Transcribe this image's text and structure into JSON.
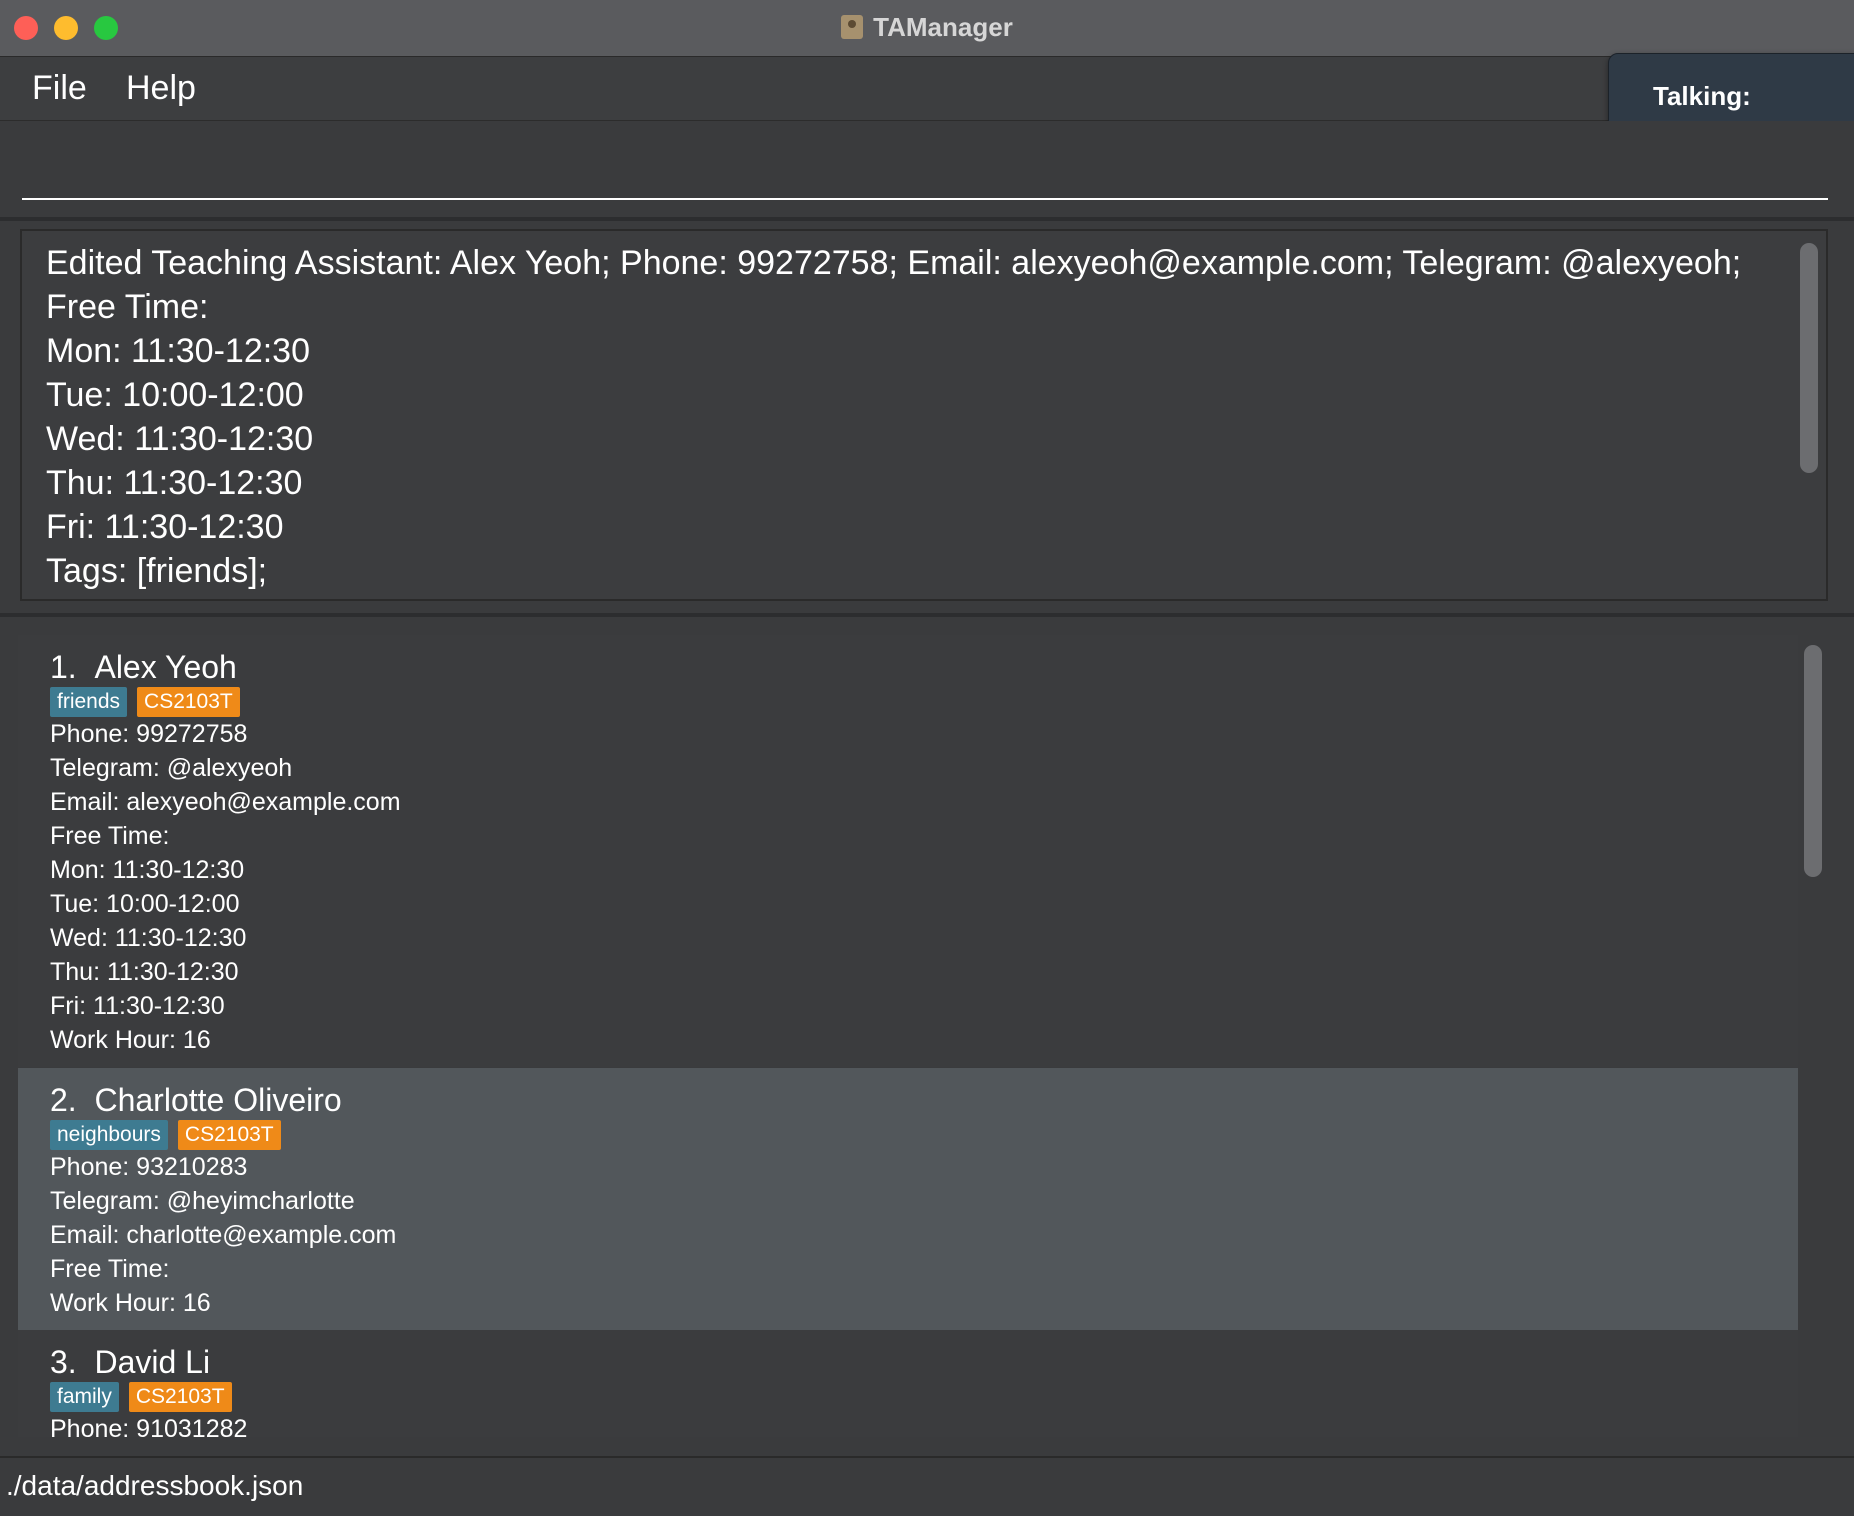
{
  "window": {
    "title": "TAManager"
  },
  "menu": {
    "file": "File",
    "help": "Help"
  },
  "talking_label": "Talking:",
  "command": {
    "value": "",
    "placeholder": ""
  },
  "result": {
    "lines": [
      "Edited Teaching Assistant: Alex Yeoh; Phone: 99272758; Email: alexyeoh@example.com; Telegram: @alexyeoh;",
      "Free Time:",
      "Mon: 11:30-12:30",
      "Tue: 10:00-12:00",
      "Wed: 11:30-12:30",
      "Thu: 11:30-12:30",
      "Fri: 11:30-12:30",
      "Tags: [friends];"
    ]
  },
  "tas": [
    {
      "index": "1.",
      "name": "Alex Yeoh",
      "tags": [
        "friends",
        "CS2103T"
      ],
      "phone": "Phone: 99272758",
      "telegram": "Telegram: @alexyeoh",
      "email": "Email: alexyeoh@example.com",
      "free_time_label": "Free Time:",
      "free_time": [
        "Mon: 11:30-12:30",
        "Tue: 10:00-12:00",
        "Wed: 11:30-12:30",
        "Thu: 11:30-12:30",
        "Fri: 11:30-12:30"
      ],
      "work_hour": "Work Hour: 16"
    },
    {
      "index": "2.",
      "name": "Charlotte Oliveiro",
      "tags": [
        "neighbours",
        "CS2103T"
      ],
      "phone": "Phone: 93210283",
      "telegram": "Telegram: @heyimcharlotte",
      "email": "Email: charlotte@example.com",
      "free_time_label": "Free Time:",
      "work_hour": "Work Hour: 16"
    },
    {
      "index": "3.",
      "name": "David Li",
      "tags": [
        "family",
        "CS2103T"
      ],
      "phone": "Phone: 91031282"
    }
  ],
  "status": {
    "file_path": "./data/addressbook.json"
  },
  "colors": {
    "tag_blue": "#3e7b91",
    "tag_orange": "#ef8a18",
    "selected_card": "#52575b"
  }
}
